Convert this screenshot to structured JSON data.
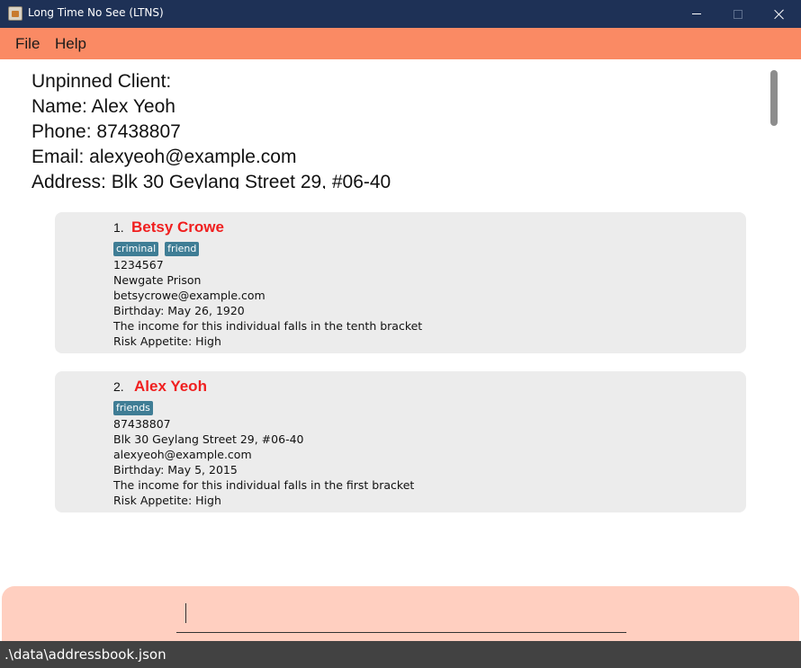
{
  "window": {
    "title": "Long Time No See (LTNS)"
  },
  "menu": {
    "file": "File",
    "help": "Help"
  },
  "detail": {
    "heading": "Unpinned Client:",
    "name": "Name: Alex Yeoh",
    "phone": "Phone: 87438807",
    "email": "Email: alexyeoh@example.com",
    "address": "Address: Blk 30 Geylang Street 29, #06-40"
  },
  "clients": [
    {
      "index": "1.",
      "name": "Betsy Crowe",
      "tags": [
        "criminal",
        "friend"
      ],
      "phone": "1234567",
      "address": "Newgate Prison",
      "email": "betsycrowe@example.com",
      "birthday": "Birthday: May 26, 1920",
      "income": "The income for this individual falls in the tenth bracket",
      "risk": "Risk Appetite: High"
    },
    {
      "index": "2.",
      "name": "Alex Yeoh",
      "tags": [
        "friends"
      ],
      "phone": "87438807",
      "address": "Blk 30 Geylang Street 29, #06-40",
      "email": "alexyeoh@example.com",
      "birthday": "Birthday: May 5, 2015",
      "income": "The income for this individual falls in the first bracket",
      "risk": "Risk Appetite: High"
    }
  ],
  "command": {
    "value": ""
  },
  "status": {
    "path": ".\\data\\addressbook.json"
  },
  "colors": {
    "titlebar": "#1e3156",
    "menubar": "#fa8a64",
    "name_accent": "#f01f1f",
    "tag": "#3f7d95",
    "command_bg": "#ffcfc0",
    "statusbar": "#424242"
  }
}
